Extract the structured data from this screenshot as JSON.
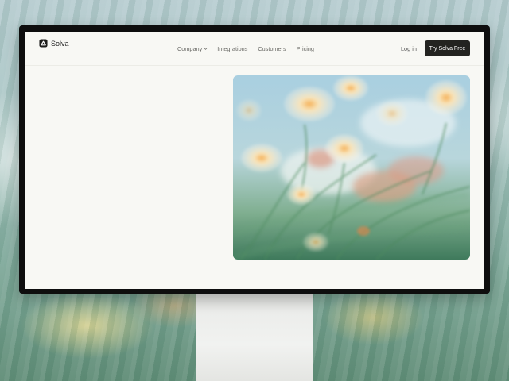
{
  "brand": {
    "name": "Solva",
    "icon": "logo-icon"
  },
  "nav": {
    "items": [
      {
        "label": "Company",
        "icon": "chevron-down-icon"
      },
      {
        "label": "Integrations"
      },
      {
        "label": "Customers"
      },
      {
        "label": "Pricing"
      }
    ],
    "login_label": "Log in",
    "cta_label": "Try Solva Free"
  },
  "colors": {
    "page_bg": "#f8f8f4",
    "cta_bg": "#232320",
    "nav_text": "#6a6a66",
    "bezel": "#0e0e0e"
  }
}
